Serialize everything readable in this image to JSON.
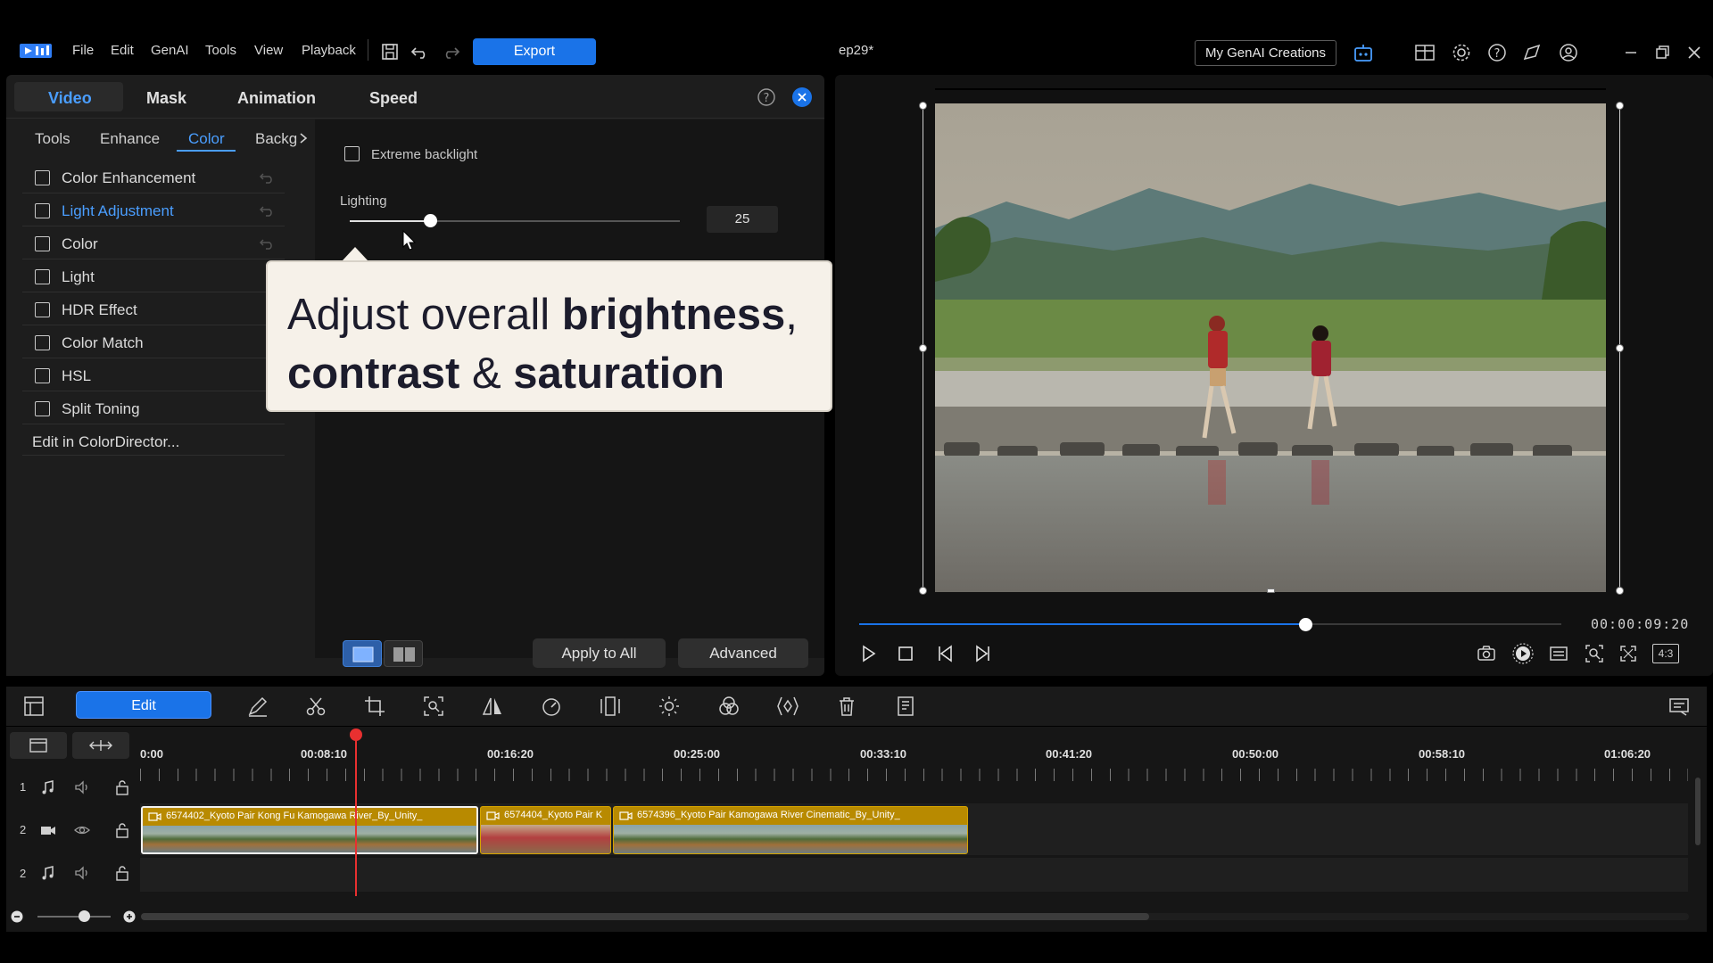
{
  "app": {
    "title": "ep29*",
    "menu": [
      "File",
      "Edit",
      "GenAI",
      "Tools",
      "View",
      "Playback"
    ],
    "export_label": "Export",
    "genai_creations_label": "My GenAI Creations"
  },
  "panel": {
    "top_tabs": [
      "Video",
      "Mask",
      "Animation",
      "Speed"
    ],
    "sub_tabs": [
      "Tools",
      "Enhance",
      "Color",
      "Backg"
    ],
    "features": [
      "Color Enhancement",
      "Light Adjustment",
      "Color",
      "Light",
      "HDR Effect",
      "Color Match",
      "HSL",
      "Split Toning"
    ],
    "edit_in_colordirector": "Edit in ColorDirector...",
    "extreme_backlight_label": "Extreme backlight",
    "lighting_label": "Lighting",
    "lighting_value": "25",
    "lighting_level": 0.25,
    "apply_to_all_label": "Apply to All",
    "advanced_label": "Advanced"
  },
  "callout": {
    "line1_normal": "Adjust overall ",
    "line1_bold": "brightness",
    "line1_tail": ",",
    "line2_bold_a": "contrast",
    "line2_normal": " & ",
    "line2_bold_b": "saturation"
  },
  "preview": {
    "timecode": "00:00:09:20",
    "aspect_label": "4:3",
    "progress": 0.635
  },
  "toolbar": {
    "edit_label": "Edit"
  },
  "timeline": {
    "ruler": [
      "0:00",
      "00:08:10",
      "00:16:20",
      "00:25:00",
      "00:33:10",
      "00:41:20",
      "00:50:00",
      "00:58:10",
      "01:06:20"
    ],
    "track_numbers": [
      "1",
      "2",
      "2"
    ],
    "clips": [
      "6574402_Kyoto Pair Kong Fu Kamogawa River_By_Unity_",
      "6574404_Kyoto Pair K",
      "6574396_Kyoto Pair Kamogawa River Cinematic_By_Unity_"
    ]
  },
  "colors": {
    "accent": "#1a73e8",
    "active_text": "#4a9eff",
    "clip": "#b88a00",
    "playhead": "#e83030"
  }
}
